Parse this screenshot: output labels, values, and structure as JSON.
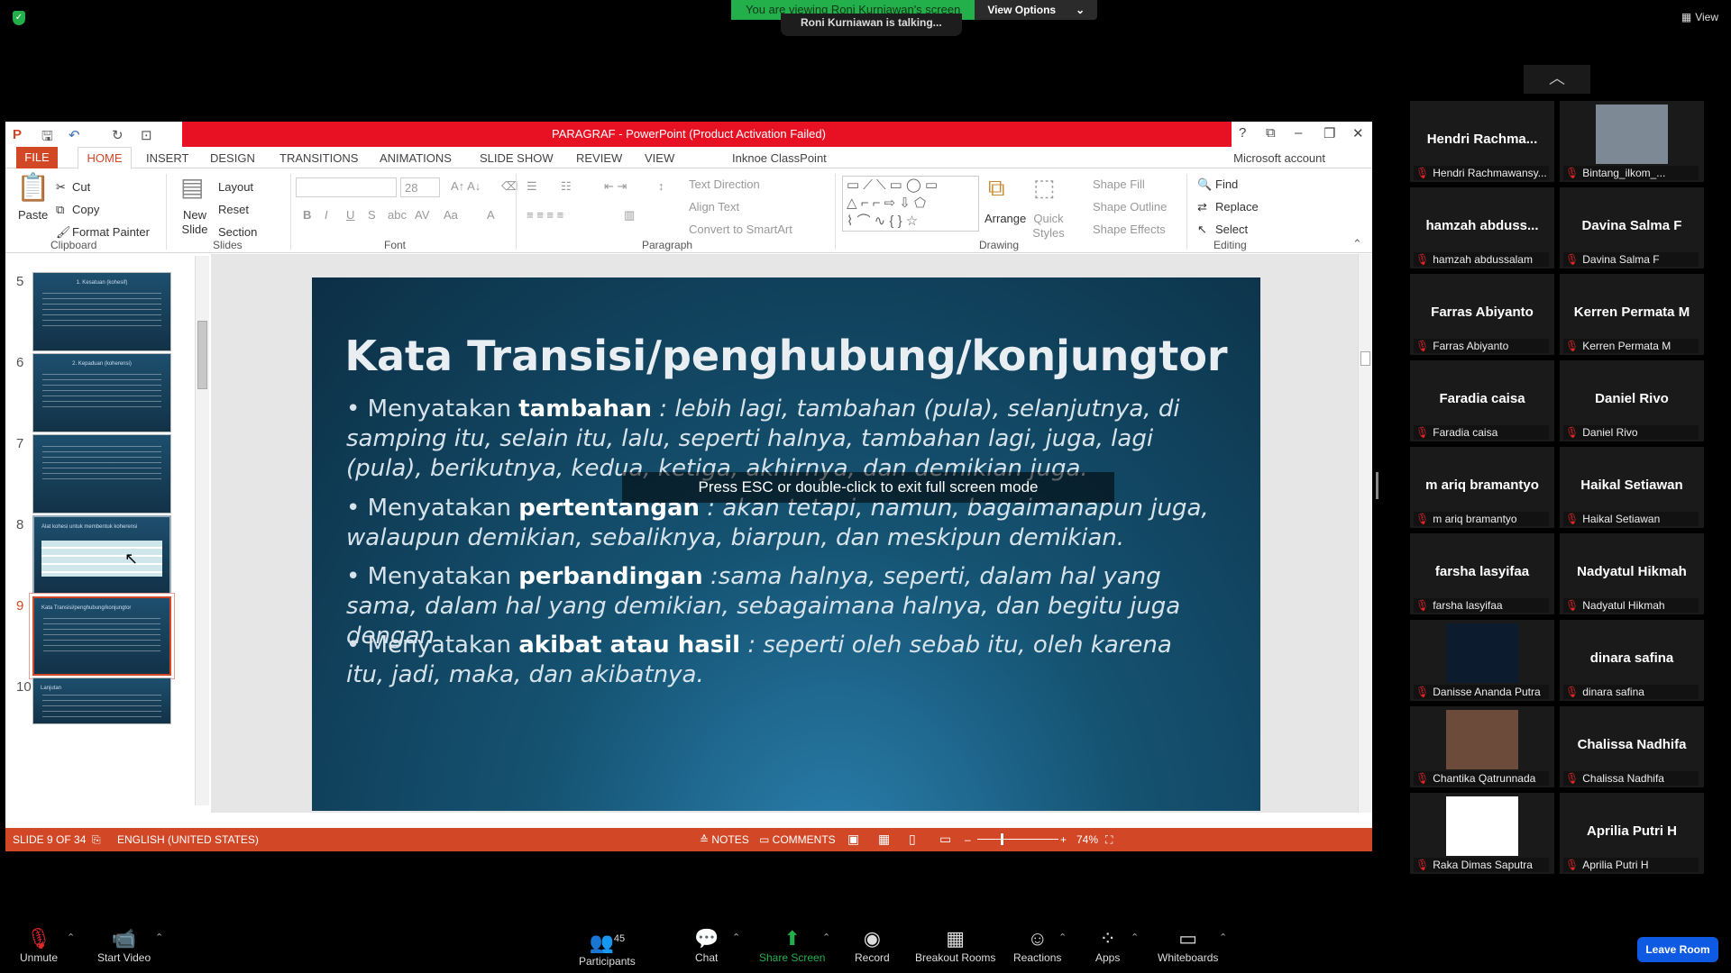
{
  "zoom": {
    "share_banner": "You are viewing Roni Kurniawan's screen",
    "view_options": "View Options",
    "talking": "Roni Kurniawan is talking...",
    "view_label": "View"
  },
  "ppt": {
    "title": "PARAGRAF - PowerPoint (Product Activation Failed)",
    "tabs": [
      "FILE",
      "HOME",
      "INSERT",
      "DESIGN",
      "TRANSITIONS",
      "ANIMATIONS",
      "SLIDE SHOW",
      "REVIEW",
      "VIEW",
      "Inknoe ClassPoint"
    ],
    "account": "Microsoft account",
    "ribbon": {
      "clipboard": {
        "label": "Clipboard",
        "paste": "Paste",
        "cut": "Cut",
        "copy": "Copy",
        "format_painter": "Format Painter"
      },
      "slides": {
        "label": "Slides",
        "new_slide": "New Slide",
        "layout": "Layout",
        "reset": "Reset",
        "section": "Section"
      },
      "font": {
        "label": "Font",
        "size": "28"
      },
      "paragraph": {
        "label": "Paragraph",
        "text_direction": "Text Direction",
        "align_text": "Align Text",
        "convert_smartart": "Convert to SmartArt"
      },
      "drawing": {
        "label": "Drawing",
        "arrange": "Arrange",
        "quick_styles": "Quick Styles",
        "shape_fill": "Shape Fill",
        "shape_outline": "Shape Outline",
        "shape_effects": "Shape Effects"
      },
      "editing": {
        "label": "Editing",
        "find": "Find",
        "replace": "Replace",
        "select": "Select"
      }
    },
    "thumbnails": [
      {
        "num": "5",
        "title": "1. Kesatuan (kohesif)"
      },
      {
        "num": "6",
        "title": "2. Kepaduan (koherensi)"
      },
      {
        "num": "7",
        "title": ""
      },
      {
        "num": "8",
        "title": "Alat kohesi untuk membentuk koherensi"
      },
      {
        "num": "9",
        "title": "Kata Transisi/penghubung/konjungtor"
      },
      {
        "num": "10",
        "title": "Lanjutan"
      }
    ],
    "slide": {
      "title": "Kata Transisi/penghubung/konjungtor",
      "bullets": [
        {
          "lead": "Menyatakan ",
          "key": "tambahan",
          "rest": " : lebih lagi, tambahan (pula), selanjutnya, di samping itu, selain itu, lalu, seperti halnya, tambahan lagi, juga, lagi (pula), berikutnya, kedua, ketiga, akhirnya, dan demikian juga."
        },
        {
          "lead": "Menyatakan ",
          "key": "pertentangan",
          "rest": " : akan tetapi, namun, bagaimanapun juga, walaupun demikian, sebaliknya, biarpun, dan meskipun demikian."
        },
        {
          "lead": "Menyatakan ",
          "key": "perbandingan",
          "rest": " :sama halnya, seperti, dalam hal yang sama, dalam hal yang demikian, sebagaimana halnya, dan begitu juga dengan"
        },
        {
          "lead": "Menyatakan ",
          "key": "akibat atau hasil",
          "rest": " : seperti oleh sebab itu, oleh karena itu, jadi, maka, dan akibatnya."
        }
      ]
    },
    "esc_hint": "Press ESC or double-click to exit full screen mode",
    "status": {
      "slide": "SLIDE 9 OF 34",
      "language": "ENGLISH (UNITED STATES)",
      "notes": "NOTES",
      "comments": "COMMENTS",
      "zoom": "74%"
    }
  },
  "participants": [
    {
      "name": "Hendri  Rachma...",
      "label": "Hendri Rachmawansy..."
    },
    {
      "name": "",
      "label": "Bintang_ilkom_..."
    },
    {
      "name": "hamzah  abduss...",
      "label": "hamzah abdussalam"
    },
    {
      "name": "Davina Salma F",
      "label": "Davina Salma F"
    },
    {
      "name": "Farras Abiyanto",
      "label": "Farras Abiyanto"
    },
    {
      "name": "Kerren Permata M",
      "label": "Kerren Permata M"
    },
    {
      "name": "Faradia caisa",
      "label": "Faradia caisa"
    },
    {
      "name": "Daniel Rivo",
      "label": "Daniel Rivo"
    },
    {
      "name": "m ariq bramantyo",
      "label": "m ariq bramantyo"
    },
    {
      "name": "Haikal Setiawan",
      "label": "Haikal Setiawan"
    },
    {
      "name": "farsha lasyifaa",
      "label": "farsha lasyifaa"
    },
    {
      "name": "Nadyatul Hikmah",
      "label": "Nadyatul Hikmah"
    },
    {
      "name": "",
      "label": "Danisse Ananda Putra"
    },
    {
      "name": "dinara safina",
      "label": "dinara safina"
    },
    {
      "name": "",
      "label": "Chantika Qatrunnada"
    },
    {
      "name": "Chalissa Nadhifa",
      "label": "Chalissa Nadhifa"
    },
    {
      "name": "",
      "label": "Raka Dimas Saputra"
    },
    {
      "name": "Aprilia Putri H",
      "label": "Aprilia Putri H"
    }
  ],
  "toolbar": {
    "unmute": "Unmute",
    "start_video": "Start Video",
    "participants": "Participants",
    "participant_count": "45",
    "chat": "Chat",
    "share_screen": "Share Screen",
    "record": "Record",
    "breakout": "Breakout Rooms",
    "reactions": "Reactions",
    "apps": "Apps",
    "whiteboards": "Whiteboards",
    "leave": "Leave Room"
  },
  "colors": {
    "ppt_accent": "#d24726",
    "title_red": "#e81123",
    "share_green": "#23b04a",
    "leave_blue": "#0e5ae3"
  }
}
